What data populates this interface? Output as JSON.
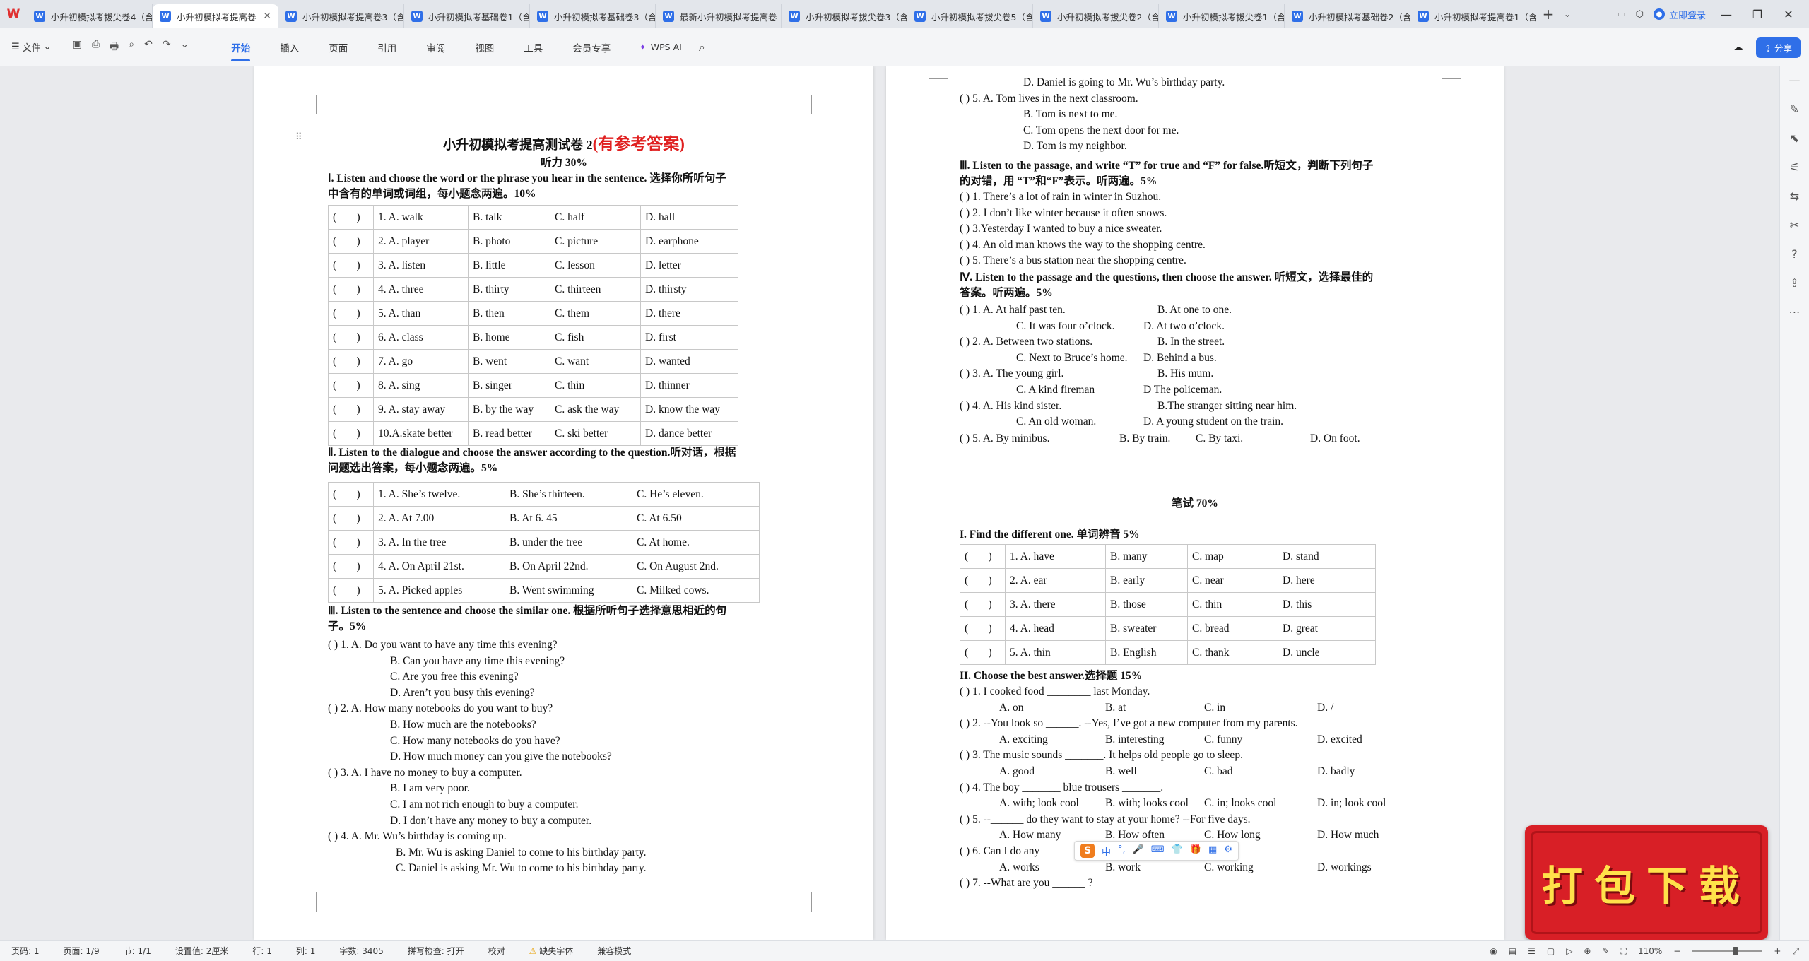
{
  "tabs": [
    {
      "label": "小升初模拟考拔尖卷4（含",
      "active": false
    },
    {
      "label": "小升初模拟考提高卷",
      "active": true
    },
    {
      "label": "小升初模拟考提高卷3（含",
      "active": false
    },
    {
      "label": "小升初模拟考基础卷1（含",
      "active": false
    },
    {
      "label": "小升初模拟考基础卷3（含",
      "active": false
    },
    {
      "label": "最新小升初模拟考提高卷",
      "active": false
    },
    {
      "label": "小升初模拟考拔尖卷3（含",
      "active": false
    },
    {
      "label": "小升初模拟考拔尖卷5（含",
      "active": false
    },
    {
      "label": "小升初模拟考拔尖卷2（含",
      "active": false
    },
    {
      "label": "小升初模拟考拔尖卷1（含",
      "active": false
    },
    {
      "label": "小升初模拟考基础卷2（含",
      "active": false
    },
    {
      "label": "小升初模拟考提高卷1（含",
      "active": false
    }
  ],
  "window": {
    "login": "立即登录",
    "share": "分享"
  },
  "toolbar": {
    "file": "文件",
    "menu": [
      "开始",
      "插入",
      "页面",
      "引用",
      "审阅",
      "视图",
      "工具",
      "会员专享"
    ],
    "wps_ai": "WPS AI"
  },
  "page1": {
    "title_main": "小升初模拟考提高测试卷 2",
    "title_red": "(有参考答案)",
    "listening": "听力 30%",
    "s1_heading_a": "Ⅰ. Listen and choose the word or the phrase you hear in the sentence.  选择你所听句子",
    "s1_heading_b": "中含有的单词或词组，每小题念两遍。10%",
    "table1": [
      [
        "(",
        ")",
        "1. A. walk",
        "B. talk",
        "C. half",
        "D. hall"
      ],
      [
        "(",
        ")",
        "2. A. player",
        "B. photo",
        "C. picture",
        "D. earphone"
      ],
      [
        "(",
        ")",
        "3. A. listen",
        "B. little",
        "C. lesson",
        "D. letter"
      ],
      [
        "(",
        ")",
        "4. A. three",
        "B. thirty",
        "C. thirteen",
        "D. thirsty"
      ],
      [
        "(",
        ")",
        "5. A. than",
        "B. then",
        "C. them",
        "D. there"
      ],
      [
        "(",
        ")",
        "6. A. class",
        "B. home",
        "C. fish",
        "D. first"
      ],
      [
        "(",
        ")",
        "7. A. go",
        "B. went",
        "C. want",
        "D. wanted"
      ],
      [
        "(",
        ")",
        "8. A. sing",
        "B. singer",
        "C. thin",
        "D. thinner"
      ],
      [
        "(",
        ")",
        "9. A. stay away",
        "B. by the way",
        "C. ask the way",
        "D. know the way"
      ],
      [
        "(",
        ")",
        "10.A.skate better",
        "B. read better",
        "C. ski better",
        "D. dance better"
      ]
    ],
    "s2_heading_a": "Ⅱ. Listen to the dialogue and choose the answer according to the question.听对话，根据",
    "s2_heading_b": "问题选出答案，每小题念两遍。5%",
    "table2": [
      [
        "(",
        ")",
        "1. A. She’s twelve.",
        "B. She’s thirteen.",
        "C. He’s eleven."
      ],
      [
        "(",
        ")",
        "2. A. At 7.00",
        "B. At 6. 45",
        "C. At 6.50"
      ],
      [
        "(",
        ")",
        "3. A. In the tree",
        "B. under the tree",
        "C. At home."
      ],
      [
        "(",
        ")",
        "4. A. On April 21st.",
        "B. On April 22nd.",
        "C. On August 2nd."
      ],
      [
        "(",
        ")",
        "5. A. Picked apples",
        "B. Went swimming",
        "C. Milked cows."
      ]
    ],
    "s3_heading_a": "Ⅲ. Listen to the sentence and choose the similar one.  根据所听句子选择意思相近的句",
    "s3_heading_b": "子。5%",
    "s3_lines": [
      "(          ) 1. A. Do you want to have any time this evening?",
      "B. Can you have any time this evening?",
      "C. Are you free this evening?",
      "D. Aren’t you busy this evening?",
      "(          ) 2. A. How many notebooks do you want to buy?",
      "B. How much are the notebooks?",
      "C. How many notebooks do you have?",
      "D. How much money can you give the notebooks?",
      "(          ) 3. A. I have no money to buy a computer.",
      "B. I am very poor.",
      "C. I am not rich enough to buy a computer.",
      "D. I don’t have any money to buy a computer.",
      "(           ) 4. A. Mr. Wu’s birthday is coming up.",
      "B. Mr. Wu is asking Daniel to come to his birthday party.",
      "C. Daniel is asking Mr. Wu to come to his birthday party."
    ]
  },
  "page2": {
    "top_lines": [
      "D. Daniel is going to Mr. Wu’s birthday party.",
      "(           ) 5. A. Tom lives in the next classroom.",
      "B. Tom is next to me.",
      "C. Tom opens the next door for me.",
      "D. Tom is my neighbor."
    ],
    "s3_heading_a": "Ⅲ. Listen to the passage, and write “T” for true and “F” for false.听短文，判断下列句子",
    "s3_heading_b": "的对错，用 “T”和“F”表示。听两遍。5%",
    "tf_lines": [
      "(         ) 1. There’s a lot of rain in winter in Suzhou.",
      "(         ) 2. I don’t like winter because it often snows.",
      "(         ) 3.Yesterday I wanted to buy a nice sweater.",
      "(         ) 4. An old man knows the way to the shopping centre.",
      "(         ) 5. There’s a bus station near the shopping centre."
    ],
    "s4_heading_a": "Ⅳ. Listen to the passage and the questions, then choose the answer. 听短文，选择最佳的",
    "s4_heading_b": "答案。听两遍。5%",
    "s4_lines": [
      [
        "(         ) 1. A. At half past ten.",
        "B. At one to one."
      ],
      [
        "C. It was four o’clock.",
        "D. At two o’clock."
      ],
      [
        "(         ) 2. A. Between two stations.",
        "B. In the street."
      ],
      [
        "C. Next to Bruce’s home.",
        "D. Behind a bus."
      ],
      [
        "(         ) 3. A. The young girl.",
        "B. His mum."
      ],
      [
        "C. A kind fireman",
        "D The policeman."
      ],
      [
        "(         ) 4. A. His kind sister.",
        "B.The stranger sitting near him."
      ],
      [
        "C. An old woman.",
        "D. A young student on the train."
      ]
    ],
    "s4_q5": [
      "(         ) 5. A. By minibus.",
      "B. By train.",
      "C. By taxi.",
      "D. On foot."
    ],
    "written": "笔试 70%",
    "w1_heading": "I. Find the different one.  单词辨音 5%",
    "table3": [
      [
        "(",
        ")",
        "1. A. have",
        "B. many",
        "C. map",
        "D. stand"
      ],
      [
        "(",
        ")",
        "2. A. ear",
        "B. early",
        "C. near",
        "D. here"
      ],
      [
        "(",
        ")",
        "3. A. there",
        "B. those",
        "C. thin",
        "D. this"
      ],
      [
        "(",
        ")",
        "4. A. head",
        "B. sweater",
        "C. bread",
        "D. great"
      ],
      [
        "(",
        ")",
        "5. A. thin",
        "B. English",
        "C. thank",
        "D. uncle"
      ]
    ],
    "w2_heading": "II. Choose the best answer.选择题 15%",
    "w2_lines": [
      {
        "q": "(         ) 1. I cooked food ________ last Monday.",
        "opts": [
          "A. on",
          "B. at",
          "C. in",
          "D. /"
        ]
      },
      {
        "q": "(         ) 2. --You look so  ______. --Yes, I’ve got a new computer from my parents.",
        "opts": [
          "A. exciting",
          "B. interesting",
          "C. funny",
          "D. excited"
        ]
      },
      {
        "q": "(         ) 3. The music sounds _______. It helps old people go to sleep.",
        "opts": [
          "A. good",
          "B. well",
          "C. bad",
          "D. badly"
        ]
      },
      {
        "q": "(         ) 4. The boy _______ blue trousers _______.",
        "opts": [
          "A. with; look cool",
          "B. with; looks cool",
          "C. in; looks cool",
          "D. in; look cool"
        ]
      },
      {
        "q": "(         ) 5. --______ do they want to stay at your home? --For five days.",
        "opts": [
          "A. How many",
          "B. How often",
          "C. How long",
          "D. How much"
        ]
      },
      {
        "q": "(         ) 6. Can I do any",
        "opts": [
          "A. works",
          "B. work",
          "C. working",
          "D. workings"
        ]
      }
    ],
    "w2_q7": "(         ) 7. --What are you ______ ?"
  },
  "statusbar": {
    "page": "页码: 1",
    "pages": "页面: 1/9",
    "section": "节: 1/1",
    "setting": "设置值: 2厘米",
    "row": "行: 1",
    "col": "列: 1",
    "words": "字数: 3405",
    "spell": "拼写检查: 打开",
    "proof": "校对",
    "missing_font": "缺失字体",
    "compat": "兼容模式",
    "zoom": "110%"
  },
  "banner": {
    "text": "打包下载"
  },
  "ime": {
    "items": [
      "中",
      "°,",
      "🎤",
      "⌨",
      "👕",
      "🎁",
      "▦",
      "⚙"
    ]
  }
}
